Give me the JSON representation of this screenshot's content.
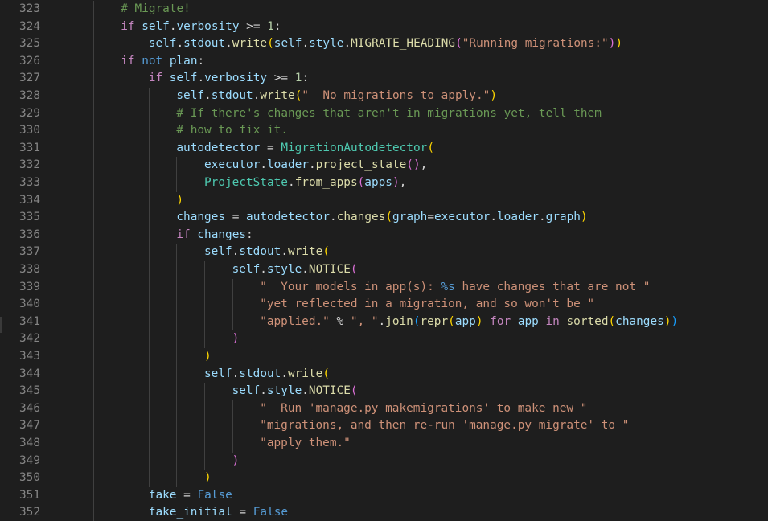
{
  "editor": {
    "language": "python",
    "colors": {
      "background": "#1e1e1e",
      "line_number": "#858585",
      "default_text": "#d4d4d4",
      "keyword_control": "#c586c0",
      "keyword_constant": "#569cd6",
      "variable": "#9cdcfe",
      "function": "#dcdcaa",
      "string": "#ce9178",
      "comment": "#6a9955",
      "class_name": "#4ec9b0",
      "number": "#b5cea8",
      "format_placeholder": "#569cd6",
      "bracket_level_1": "#ffd700",
      "bracket_level_2": "#da70d6",
      "bracket_level_3": "#179fff"
    },
    "lines": [
      {
        "num": "323",
        "indent": 2,
        "tokens": [
          {
            "t": "# Migrate!",
            "c": "comment"
          }
        ]
      },
      {
        "num": "324",
        "indent": 2,
        "tokens": [
          {
            "t": "if",
            "c": "keyword_control"
          },
          {
            "t": " "
          },
          {
            "t": "self",
            "c": "variable"
          },
          {
            "t": "."
          },
          {
            "t": "verbosity",
            "c": "variable"
          },
          {
            "t": " >= "
          },
          {
            "t": "1",
            "c": "number"
          },
          {
            "t": ":"
          }
        ]
      },
      {
        "num": "325",
        "indent": 3,
        "tokens": [
          {
            "t": "self",
            "c": "variable"
          },
          {
            "t": "."
          },
          {
            "t": "stdout",
            "c": "variable"
          },
          {
            "t": "."
          },
          {
            "t": "write",
            "c": "function"
          },
          {
            "t": "(",
            "c": "bracket_level_1"
          },
          {
            "t": "self",
            "c": "variable"
          },
          {
            "t": "."
          },
          {
            "t": "style",
            "c": "variable"
          },
          {
            "t": "."
          },
          {
            "t": "MIGRATE_HEADING",
            "c": "function"
          },
          {
            "t": "(",
            "c": "bracket_level_2"
          },
          {
            "t": "\"Running migrations:\"",
            "c": "string"
          },
          {
            "t": ")",
            "c": "bracket_level_2"
          },
          {
            "t": ")",
            "c": "bracket_level_1"
          }
        ]
      },
      {
        "num": "326",
        "indent": 2,
        "tokens": [
          {
            "t": "if",
            "c": "keyword_control"
          },
          {
            "t": " "
          },
          {
            "t": "not",
            "c": "keyword_constant"
          },
          {
            "t": " "
          },
          {
            "t": "plan",
            "c": "variable"
          },
          {
            "t": ":"
          }
        ]
      },
      {
        "num": "327",
        "indent": 3,
        "tokens": [
          {
            "t": "if",
            "c": "keyword_control"
          },
          {
            "t": " "
          },
          {
            "t": "self",
            "c": "variable"
          },
          {
            "t": "."
          },
          {
            "t": "verbosity",
            "c": "variable"
          },
          {
            "t": " >= "
          },
          {
            "t": "1",
            "c": "number"
          },
          {
            "t": ":"
          }
        ]
      },
      {
        "num": "328",
        "indent": 4,
        "tokens": [
          {
            "t": "self",
            "c": "variable"
          },
          {
            "t": "."
          },
          {
            "t": "stdout",
            "c": "variable"
          },
          {
            "t": "."
          },
          {
            "t": "write",
            "c": "function"
          },
          {
            "t": "(",
            "c": "bracket_level_1"
          },
          {
            "t": "\"  No migrations to apply.\"",
            "c": "string"
          },
          {
            "t": ")",
            "c": "bracket_level_1"
          }
        ]
      },
      {
        "num": "329",
        "indent": 4,
        "tokens": [
          {
            "t": "# If there's changes that aren't in migrations yet, tell them",
            "c": "comment"
          }
        ]
      },
      {
        "num": "330",
        "indent": 4,
        "tokens": [
          {
            "t": "# how to fix it.",
            "c": "comment"
          }
        ]
      },
      {
        "num": "331",
        "indent": 4,
        "tokens": [
          {
            "t": "autodetector",
            "c": "variable"
          },
          {
            "t": " = "
          },
          {
            "t": "MigrationAutodetector",
            "c": "class_name"
          },
          {
            "t": "(",
            "c": "bracket_level_1"
          }
        ]
      },
      {
        "num": "332",
        "indent": 5,
        "tokens": [
          {
            "t": "executor",
            "c": "variable"
          },
          {
            "t": "."
          },
          {
            "t": "loader",
            "c": "variable"
          },
          {
            "t": "."
          },
          {
            "t": "project_state",
            "c": "function"
          },
          {
            "t": "()",
            "c": "bracket_level_2"
          },
          {
            "t": ","
          }
        ]
      },
      {
        "num": "333",
        "indent": 5,
        "tokens": [
          {
            "t": "ProjectState",
            "c": "class_name"
          },
          {
            "t": "."
          },
          {
            "t": "from_apps",
            "c": "function"
          },
          {
            "t": "(",
            "c": "bracket_level_2"
          },
          {
            "t": "apps",
            "c": "variable"
          },
          {
            "t": ")",
            "c": "bracket_level_2"
          },
          {
            "t": ","
          }
        ]
      },
      {
        "num": "334",
        "indent": 4,
        "tokens": [
          {
            "t": ")",
            "c": "bracket_level_1"
          }
        ]
      },
      {
        "num": "335",
        "indent": 4,
        "tokens": [
          {
            "t": "changes",
            "c": "variable"
          },
          {
            "t": " = "
          },
          {
            "t": "autodetector",
            "c": "variable"
          },
          {
            "t": "."
          },
          {
            "t": "changes",
            "c": "function"
          },
          {
            "t": "(",
            "c": "bracket_level_1"
          },
          {
            "t": "graph",
            "c": "variable"
          },
          {
            "t": "="
          },
          {
            "t": "executor",
            "c": "variable"
          },
          {
            "t": "."
          },
          {
            "t": "loader",
            "c": "variable"
          },
          {
            "t": "."
          },
          {
            "t": "graph",
            "c": "variable"
          },
          {
            "t": ")",
            "c": "bracket_level_1"
          }
        ]
      },
      {
        "num": "336",
        "indent": 4,
        "tokens": [
          {
            "t": "if",
            "c": "keyword_control"
          },
          {
            "t": " "
          },
          {
            "t": "changes",
            "c": "variable"
          },
          {
            "t": ":"
          }
        ]
      },
      {
        "num": "337",
        "indent": 5,
        "tokens": [
          {
            "t": "self",
            "c": "variable"
          },
          {
            "t": "."
          },
          {
            "t": "stdout",
            "c": "variable"
          },
          {
            "t": "."
          },
          {
            "t": "write",
            "c": "function"
          },
          {
            "t": "(",
            "c": "bracket_level_1"
          }
        ]
      },
      {
        "num": "338",
        "indent": 6,
        "tokens": [
          {
            "t": "self",
            "c": "variable"
          },
          {
            "t": "."
          },
          {
            "t": "style",
            "c": "variable"
          },
          {
            "t": "."
          },
          {
            "t": "NOTICE",
            "c": "function"
          },
          {
            "t": "(",
            "c": "bracket_level_2"
          }
        ]
      },
      {
        "num": "339",
        "indent": 7,
        "tokens": [
          {
            "t": "\"  Your models in app(s): ",
            "c": "string"
          },
          {
            "t": "%s",
            "c": "format_placeholder"
          },
          {
            "t": " have changes that are not \"",
            "c": "string"
          }
        ]
      },
      {
        "num": "340",
        "indent": 7,
        "tokens": [
          {
            "t": "\"yet reflected in a migration, and so won't be \"",
            "c": "string"
          }
        ]
      },
      {
        "num": "341",
        "indent": 7,
        "tokens": [
          {
            "t": "\"applied.\"",
            "c": "string"
          },
          {
            "t": " % "
          },
          {
            "t": "\", \"",
            "c": "string"
          },
          {
            "t": "."
          },
          {
            "t": "join",
            "c": "function"
          },
          {
            "t": "(",
            "c": "bracket_level_3"
          },
          {
            "t": "repr",
            "c": "function"
          },
          {
            "t": "(",
            "c": "bracket_level_1"
          },
          {
            "t": "app",
            "c": "variable"
          },
          {
            "t": ")",
            "c": "bracket_level_1"
          },
          {
            "t": " "
          },
          {
            "t": "for",
            "c": "keyword_control"
          },
          {
            "t": " "
          },
          {
            "t": "app",
            "c": "variable"
          },
          {
            "t": " "
          },
          {
            "t": "in",
            "c": "keyword_control"
          },
          {
            "t": " "
          },
          {
            "t": "sorted",
            "c": "function"
          },
          {
            "t": "(",
            "c": "bracket_level_1"
          },
          {
            "t": "changes",
            "c": "variable"
          },
          {
            "t": ")",
            "c": "bracket_level_1"
          },
          {
            "t": ")",
            "c": "bracket_level_3"
          }
        ]
      },
      {
        "num": "342",
        "indent": 6,
        "tokens": [
          {
            "t": ")",
            "c": "bracket_level_2"
          }
        ]
      },
      {
        "num": "343",
        "indent": 5,
        "tokens": [
          {
            "t": ")",
            "c": "bracket_level_1"
          }
        ]
      },
      {
        "num": "344",
        "indent": 5,
        "tokens": [
          {
            "t": "self",
            "c": "variable"
          },
          {
            "t": "."
          },
          {
            "t": "stdout",
            "c": "variable"
          },
          {
            "t": "."
          },
          {
            "t": "write",
            "c": "function"
          },
          {
            "t": "(",
            "c": "bracket_level_1"
          }
        ]
      },
      {
        "num": "345",
        "indent": 6,
        "tokens": [
          {
            "t": "self",
            "c": "variable"
          },
          {
            "t": "."
          },
          {
            "t": "style",
            "c": "variable"
          },
          {
            "t": "."
          },
          {
            "t": "NOTICE",
            "c": "function"
          },
          {
            "t": "(",
            "c": "bracket_level_2"
          }
        ]
      },
      {
        "num": "346",
        "indent": 7,
        "tokens": [
          {
            "t": "\"  Run 'manage.py makemigrations' to make new \"",
            "c": "string"
          }
        ]
      },
      {
        "num": "347",
        "indent": 7,
        "tokens": [
          {
            "t": "\"migrations, and then re-run 'manage.py migrate' to \"",
            "c": "string"
          }
        ]
      },
      {
        "num": "348",
        "indent": 7,
        "tokens": [
          {
            "t": "\"apply them.\"",
            "c": "string"
          }
        ]
      },
      {
        "num": "349",
        "indent": 6,
        "tokens": [
          {
            "t": ")",
            "c": "bracket_level_2"
          }
        ]
      },
      {
        "num": "350",
        "indent": 5,
        "tokens": [
          {
            "t": ")",
            "c": "bracket_level_1"
          }
        ]
      },
      {
        "num": "351",
        "indent": 3,
        "tokens": [
          {
            "t": "fake",
            "c": "variable"
          },
          {
            "t": " = "
          },
          {
            "t": "False",
            "c": "keyword_constant"
          }
        ]
      },
      {
        "num": "352",
        "indent": 3,
        "tokens": [
          {
            "t": "fake_initial",
            "c": "variable"
          },
          {
            "t": " = "
          },
          {
            "t": "False",
            "c": "keyword_constant"
          }
        ]
      }
    ]
  }
}
